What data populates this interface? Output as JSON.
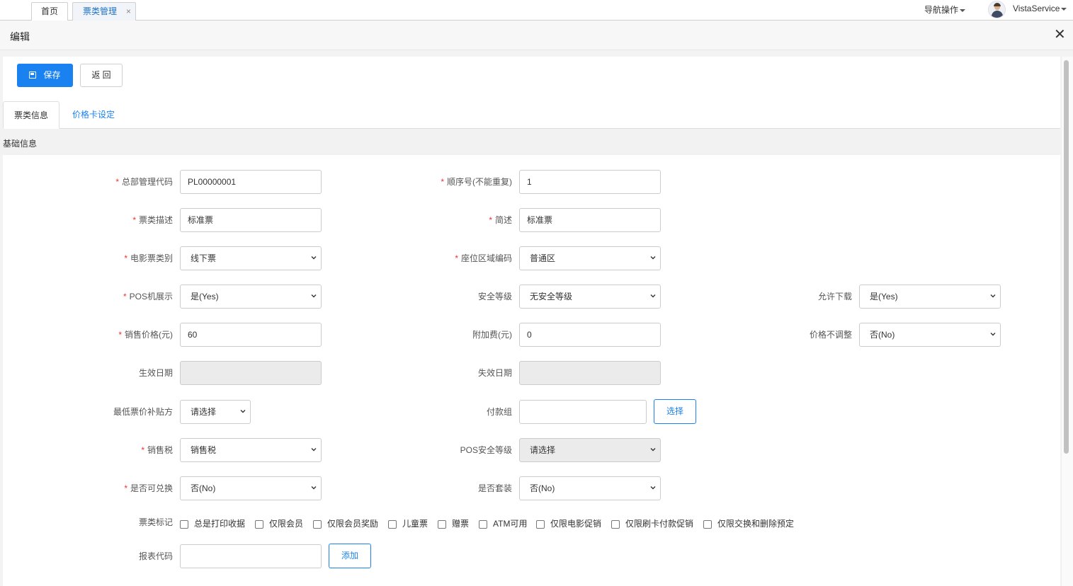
{
  "top_tabs": [
    {
      "label": "首页"
    },
    {
      "label": "票类管理",
      "close": "×"
    }
  ],
  "nav_ops": "导航操作",
  "user": "VistaService",
  "header": {
    "title": "编辑",
    "close": "✕"
  },
  "actions": {
    "save": "保存",
    "back": "返 回"
  },
  "form_tabs": [
    "票类信息",
    "价格卡设定"
  ],
  "section_title": "基础信息",
  "fields": {
    "hq_code": {
      "label": "总部管理代码",
      "value": "PL00000001"
    },
    "seq_no": {
      "label": "顺序号(不能重复)",
      "value": "1"
    },
    "ticket_desc": {
      "label": "票类描述",
      "value": "标准票"
    },
    "short_desc": {
      "label": "简述",
      "value": "标准票"
    },
    "film_ticket_type": {
      "label": "电影票类别",
      "value": "线下票"
    },
    "seat_area_code": {
      "label": "座位区域编码",
      "value": "普通区"
    },
    "pos_display": {
      "label": "POS机展示",
      "value": "是(Yes)"
    },
    "security_level": {
      "label": "安全等级",
      "value": "无安全等级"
    },
    "allow_download": {
      "label": "允许下载",
      "value": "是(Yes)"
    },
    "sale_price": {
      "label": "销售价格(元)",
      "value": "60"
    },
    "surcharge": {
      "label": "附加费(元)",
      "value": "0"
    },
    "price_no_adjust": {
      "label": "价格不调整",
      "value": "否(No)"
    },
    "effective_date": {
      "label": "生效日期",
      "value": ""
    },
    "expire_date": {
      "label": "失效日期",
      "value": ""
    },
    "min_price_subsidy": {
      "label": "最低票价补贴方",
      "value": "请选择"
    },
    "payment_group": {
      "label": "付款组",
      "value": "",
      "button": "选择"
    },
    "sales_tax": {
      "label": "销售税",
      "value": "销售税"
    },
    "pos_security_level": {
      "label": "POS安全等级",
      "value": "请选择"
    },
    "exchangeable": {
      "label": "是否可兑换",
      "value": "否(No)"
    },
    "is_package": {
      "label": "是否套装",
      "value": "否(No)"
    },
    "ticket_flags": {
      "label": "票类标记",
      "options": [
        "总是打印收据",
        "仅限会员",
        "仅限会员奖励",
        "儿童票",
        "赠票",
        "ATM可用",
        "仅限电影促销",
        "仅限刷卡付款促销",
        "仅限交换和删除预定"
      ]
    },
    "report_code": {
      "label": "报表代码",
      "value": "",
      "button": "添加"
    }
  },
  "icons": [
    "close-icon",
    "save-icon",
    "caret-down-icon",
    "chevron-down-icon",
    "avatar"
  ],
  "colors": {
    "primary": "#1a82f0",
    "required": "#e33333",
    "active_tab_text": "#1f73c9"
  }
}
